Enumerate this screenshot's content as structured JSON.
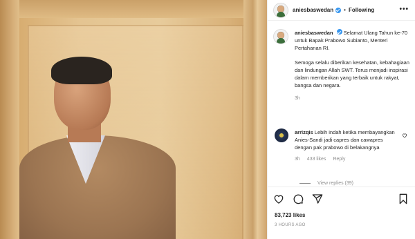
{
  "post": {
    "username": "aniesbaswedan",
    "separator": "•",
    "follow_status": "Following",
    "more_label": "•••"
  },
  "caption": {
    "username": "aniesbaswedan",
    "line1": "Selamat Ulang Tahun ke-70 untuk Bapak Prabowo Subianto, Menteri Pertahanan RI.",
    "line2": "Semoga selalu diberikan kesehatan, kebahagiaan dan lindungan Allah SWT. Terus menjadi inspirasi dalam memberikan yang terbaik untuk rakyat, bangsa dan negara.",
    "time": "3h"
  },
  "comment": {
    "username": "arrizqis",
    "text": "Lebih indah ketika membayangkan Anies-Sandi jadi capres dan cawapres dengan pak prabowo di belakangnya",
    "time": "3h",
    "likes": "433 likes",
    "reply_label": "Reply"
  },
  "view_replies": "View replies (39)",
  "likes_count": "83,723 likes",
  "posted_ago": "3 HOURS AGO"
}
